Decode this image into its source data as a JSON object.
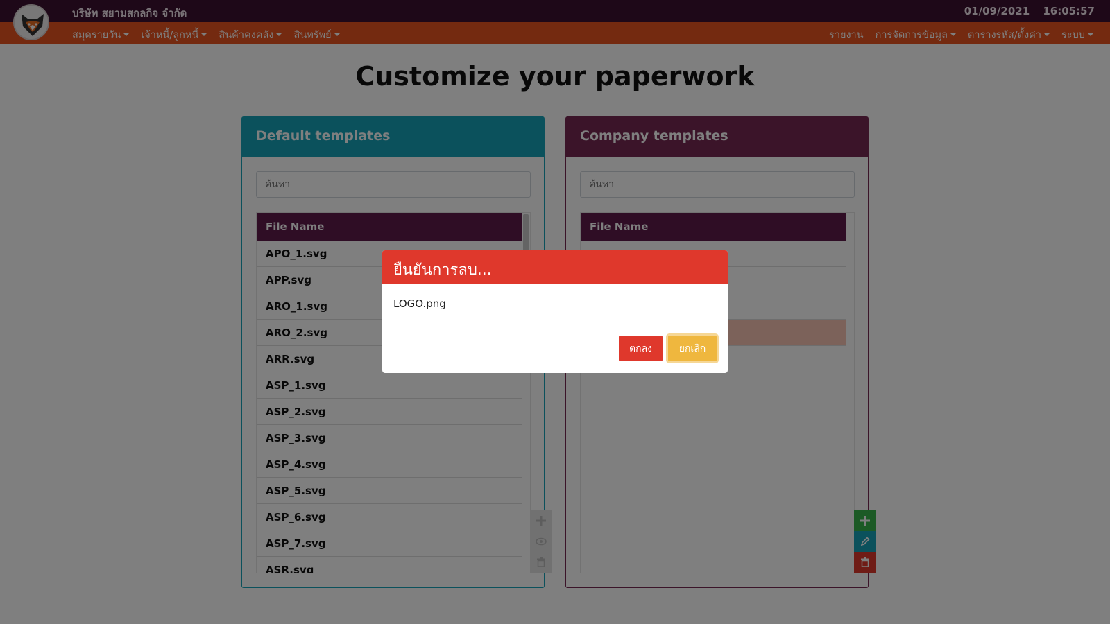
{
  "header": {
    "company_name": "บริษัท สยามสกลกิจ จำกัด",
    "date": "01/09/2021",
    "time": "16:05:57"
  },
  "nav": {
    "left": [
      "สมุดรายวัน",
      "เจ้าหนี้/ลูกหนี้",
      "สินค้าคงคลัง",
      "สินทรัพย์"
    ],
    "right": [
      "รายงาน",
      "การจัดการข้อมูล",
      "ตารางรหัส/ตั้งค่า",
      "ระบบ"
    ]
  },
  "page_title": "Customize your paperwork",
  "default_templates": {
    "title": "Default templates",
    "search_placeholder": "ค้นหา",
    "column": "File Name",
    "rows": [
      "APO_1.svg",
      "APP.svg",
      "ARO_1.svg",
      "ARO_2.svg",
      "ARR.svg",
      "ASP_1.svg",
      "ASP_2.svg",
      "ASP_3.svg",
      "ASP_4.svg",
      "ASP_5.svg",
      "ASP_6.svg",
      "ASP_7.svg",
      "ASR.svg"
    ]
  },
  "company_templates": {
    "title": "Company templates",
    "search_placeholder": "ค้นหา",
    "column": "File Name",
    "rows": [
      "",
      "",
      "",
      ""
    ]
  },
  "icons": {
    "add": "plus-icon",
    "view": "eye-icon",
    "edit": "pencil-icon",
    "delete": "trash-icon"
  },
  "modal": {
    "title": "ยืนยันการลบ...",
    "body": "LOGO.png",
    "ok_label": "ตกลง",
    "cancel_label": "ยกเลิก"
  },
  "colors": {
    "topbar": "#3c1130",
    "navbar": "#e95420",
    "default_card": "#17a2b8",
    "company_card": "#772953",
    "danger": "#df382c",
    "warning": "#efb73e",
    "success": "#38b44a"
  }
}
